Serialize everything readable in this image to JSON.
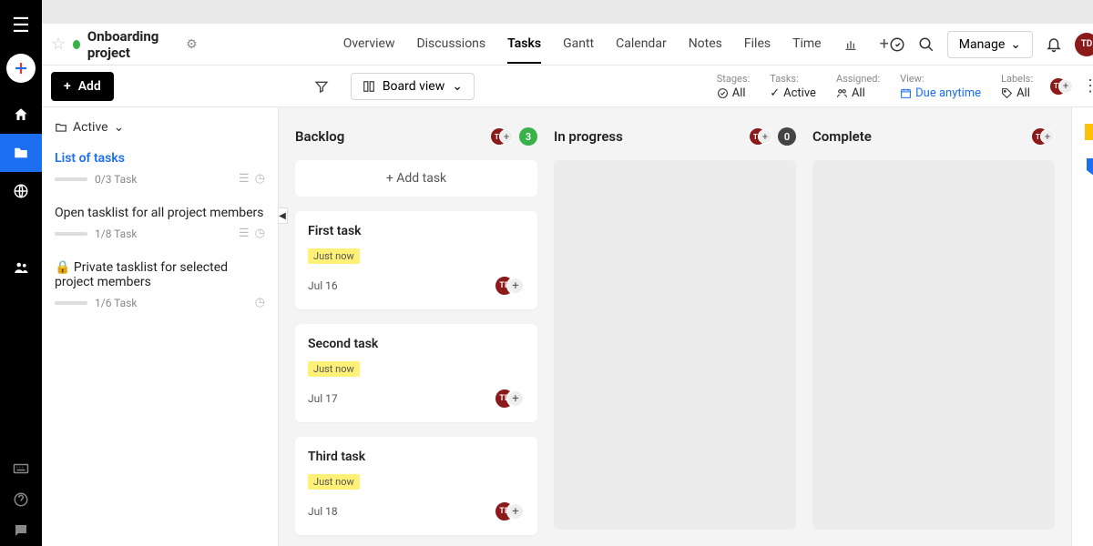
{
  "project": {
    "title": "Onboarding project"
  },
  "nav": {
    "tabs": [
      "Overview",
      "Discussions",
      "Tasks",
      "Gantt",
      "Calendar",
      "Notes",
      "Files",
      "Time"
    ],
    "active": "Tasks",
    "manage": "Manage"
  },
  "avatar": "TD",
  "toolbar": {
    "add": "Add",
    "view_label": "Board view",
    "filters": {
      "stages": {
        "label": "Stages:",
        "value": "All"
      },
      "tasks": {
        "label": "Tasks:",
        "value": "Active"
      },
      "assigned": {
        "label": "Assigned:",
        "value": "All"
      },
      "view": {
        "label": "View:",
        "value": "Due anytime"
      },
      "labels": {
        "label": "Labels:",
        "value": "All"
      }
    }
  },
  "sidebar": {
    "header": "Active",
    "items": [
      {
        "title": "List of tasks",
        "count": "0/3 Task",
        "locked": false,
        "active": true,
        "has_actions": true
      },
      {
        "title": "Open tasklist for all project members",
        "count": "1/8 Task",
        "locked": false,
        "active": false,
        "has_actions": true
      },
      {
        "title": "Private tasklist for selected project members",
        "count": "1/6 Task",
        "locked": true,
        "active": false,
        "has_actions": false
      }
    ]
  },
  "board": {
    "add_task_label": "+ Add task",
    "columns": [
      {
        "title": "Backlog",
        "count": 3,
        "count_style": "green"
      },
      {
        "title": "In progress",
        "count": 0,
        "count_style": "zero"
      },
      {
        "title": "Complete",
        "count": null,
        "count_style": null
      }
    ],
    "backlog_cards": [
      {
        "title": "First task",
        "tag": "Just now",
        "date": "Jul 16"
      },
      {
        "title": "Second task",
        "tag": "Just now",
        "date": "Jul 17"
      },
      {
        "title": "Third task",
        "tag": "Just now",
        "date": "Jul 18"
      }
    ]
  }
}
